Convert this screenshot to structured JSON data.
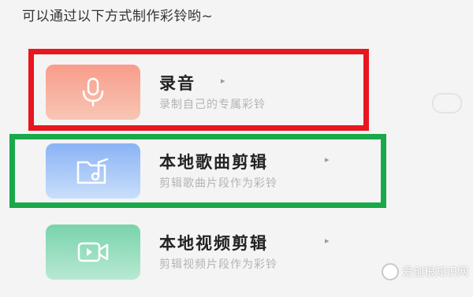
{
  "header": {
    "text": "可以通过以下方式制作彩铃哟~"
  },
  "options": [
    {
      "title": "录音",
      "subtitle": "录制自己的专属彩铃",
      "arrow": "▸",
      "icon": "microphone-icon",
      "color_top": "#f9a08e",
      "color_bottom": "#f7c5b3"
    },
    {
      "title": "本地歌曲剪辑",
      "subtitle": "剪辑歌曲片段作为彩铃",
      "arrow": "▸",
      "icon": "music-folder-icon",
      "color_top": "#8fb7f5",
      "color_bottom": "#c6dcfb"
    },
    {
      "title": "本地视频剪辑",
      "subtitle": "剪辑视频片段作为彩铃",
      "arrow": "▸",
      "icon": "video-camera-icon",
      "color_top": "#7fd6b0",
      "color_bottom": "#bdebd6"
    }
  ],
  "highlights": [
    {
      "target": "录音",
      "color": "#e8161f"
    },
    {
      "target": "本地歌曲剪辑",
      "color": "#1aa84a"
    }
  ],
  "watermark": {
    "text": "爱创根知识网"
  }
}
